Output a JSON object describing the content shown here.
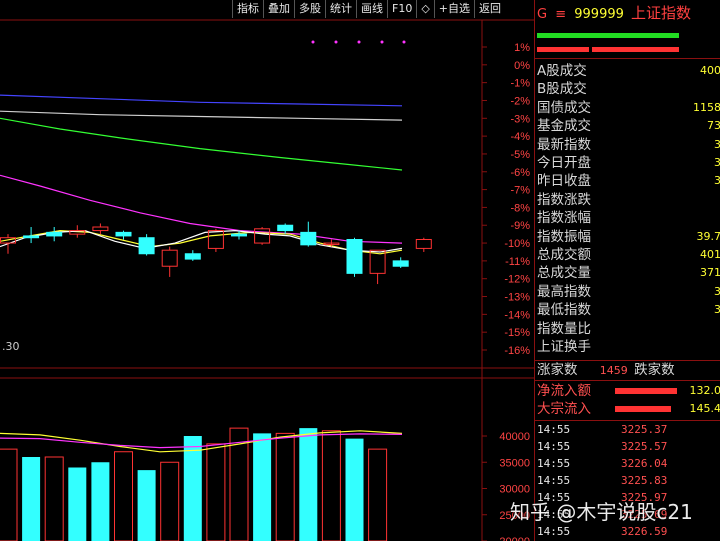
{
  "toolbar": {
    "items": [
      "指标",
      "叠加",
      "多股",
      "统计",
      "画线",
      "F10",
      "◇",
      "+自选",
      "返回"
    ]
  },
  "chart": {
    "pct_axis_labels": [
      "1%",
      "0%",
      "-1%",
      "-2%",
      "-3%",
      "-4%",
      "-5%",
      "-6%",
      "-7%",
      "-8%",
      "-9%",
      "-10%",
      "-11%",
      "-12%",
      "-13%",
      "-14%",
      "-15%",
      "-16%"
    ],
    "partial_label": ".30",
    "volume_axis_labels": [
      "40000",
      "35000",
      "30000",
      "25000",
      "20000"
    ]
  },
  "header": {
    "prefix": "G",
    "menu_glyph": "≡",
    "code": "999999",
    "name": "上证指数"
  },
  "stats": [
    {
      "label": "A股成交",
      "value": "400"
    },
    {
      "label": "B股成交",
      "value": ""
    },
    {
      "label": "国债成交",
      "value": "1158"
    },
    {
      "label": "基金成交",
      "value": "73"
    },
    {
      "label": "最新指数",
      "value": "3"
    },
    {
      "label": "今日开盘",
      "value": "3"
    },
    {
      "label": "昨日收盘",
      "value": "3"
    },
    {
      "label": "指数涨跌",
      "value": ""
    },
    {
      "label": "指数涨幅",
      "value": ""
    },
    {
      "label": "指数振幅",
      "value": "39.7"
    },
    {
      "label": "总成交额",
      "value": "401"
    },
    {
      "label": "总成交量",
      "value": "371"
    },
    {
      "label": "最高指数",
      "value": "3"
    },
    {
      "label": "最低指数",
      "value": "3"
    },
    {
      "label": "指数量比",
      "value": ""
    },
    {
      "label": "上证换手",
      "value": ""
    }
  ],
  "breadth": {
    "up_label": "涨家数",
    "up_value": "1459",
    "down_label": "跌家数"
  },
  "flows": [
    {
      "label": "净流入额",
      "value": "132.0"
    },
    {
      "label": "大宗流入",
      "value": "145.4"
    }
  ],
  "ticks": [
    {
      "time": "14:55",
      "price": "3225.37"
    },
    {
      "time": "14:55",
      "price": "3225.57"
    },
    {
      "time": "14:55",
      "price": "3226.04"
    },
    {
      "time": "14:55",
      "price": "3225.83"
    },
    {
      "time": "14:55",
      "price": "3225.97"
    },
    {
      "time": "14:55",
      "price": "3225.69"
    },
    {
      "time": "14:55",
      "price": "3226.59"
    }
  ],
  "watermark": "知乎 @木宇说股c21",
  "colors": {
    "up": "#ff3333",
    "down": "#33ffff",
    "ma5": "#ffffff",
    "ma10": "#ffff33",
    "ma20": "#ff33ff",
    "ma60": "#33ff33",
    "ma120": "#4444ff"
  },
  "candles": [
    {
      "o": -10.0,
      "c": -9.7,
      "h": -9.5,
      "l": -10.6
    },
    {
      "o": -9.6,
      "c": -9.7,
      "h": -9.1,
      "l": -10.0
    },
    {
      "o": -9.4,
      "c": -9.6,
      "h": -9.1,
      "l": -9.9
    },
    {
      "o": -9.5,
      "c": -9.3,
      "h": -9.0,
      "l": -9.7
    },
    {
      "o": -9.3,
      "c": -9.1,
      "h": -8.9,
      "l": -9.5
    },
    {
      "o": -9.4,
      "c": -9.6,
      "h": -9.3,
      "l": -9.8
    },
    {
      "o": -9.7,
      "c": -10.6,
      "h": -9.5,
      "l": -10.7
    },
    {
      "o": -11.3,
      "c": -10.4,
      "h": -10.2,
      "l": -11.9
    },
    {
      "o": -10.6,
      "c": -10.9,
      "h": -10.4,
      "l": -11.0
    },
    {
      "o": -10.3,
      "c": -9.3,
      "h": -9.2,
      "l": -10.5
    },
    {
      "o": -9.5,
      "c": -9.6,
      "h": -9.3,
      "l": -9.8
    },
    {
      "o": -10.0,
      "c": -9.2,
      "h": -9.1,
      "l": -10.1
    },
    {
      "o": -9.0,
      "c": -9.3,
      "h": -8.9,
      "l": -9.5
    },
    {
      "o": -9.4,
      "c": -10.1,
      "h": -8.8,
      "l": -10.2
    },
    {
      "o": -10.0,
      "c": -10.0,
      "h": -9.8,
      "l": -10.2
    },
    {
      "o": -9.8,
      "c": -11.7,
      "h": -9.7,
      "l": -11.9
    },
    {
      "o": -11.7,
      "c": -10.4,
      "h": -10.4,
      "l": -12.3
    },
    {
      "o": -11.0,
      "c": -11.3,
      "h": -10.8,
      "l": -11.4
    },
    {
      "o": -10.3,
      "c": -9.8,
      "h": -9.7,
      "l": -10.5
    }
  ],
  "volumes": [
    {
      "v": 37500,
      "up": true
    },
    {
      "v": 36000,
      "up": false
    },
    {
      "v": 36000,
      "up": true
    },
    {
      "v": 34000,
      "up": false
    },
    {
      "v": 35000,
      "up": false
    },
    {
      "v": 37000,
      "up": true
    },
    {
      "v": 33500,
      "up": false
    },
    {
      "v": 35000,
      "up": true
    },
    {
      "v": 40000,
      "up": false
    },
    {
      "v": 38500,
      "up": true
    },
    {
      "v": 41500,
      "up": true
    },
    {
      "v": 40500,
      "up": false
    },
    {
      "v": 40500,
      "up": true
    },
    {
      "v": 41500,
      "up": false
    },
    {
      "v": 41000,
      "up": true
    },
    {
      "v": 39500,
      "up": false
    },
    {
      "v": 37500,
      "up": true
    }
  ]
}
